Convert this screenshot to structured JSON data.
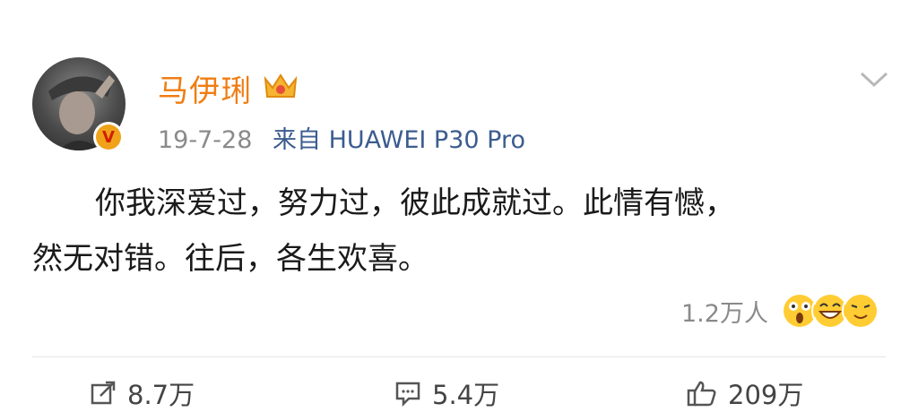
{
  "post": {
    "username": "马伊琍",
    "time": "19-7-28",
    "source": "来自 HUAWEI P30 Pro",
    "text_line1": "你我深爱过，努力过，彼此成就过。此情有憾，",
    "text_line2": "然无对错。往后，各生欢喜。",
    "reaction_count": "1.2万人",
    "verified_badge": "V"
  },
  "actions": {
    "repost_count": "8.7万",
    "comment_count": "5.4万",
    "like_count": "209万"
  },
  "colors": {
    "username": "#f07d13",
    "source": "#3b5c8f",
    "meta": "#8a8a8a",
    "badge": "#f0a21a"
  },
  "icons": [
    "crown-icon",
    "verified-icon",
    "chevron-down-icon",
    "repost-icon",
    "comment-icon",
    "like-icon",
    "surprised-emoji-icon",
    "laughing-emoji-icon",
    "grin-emoji-icon"
  ]
}
